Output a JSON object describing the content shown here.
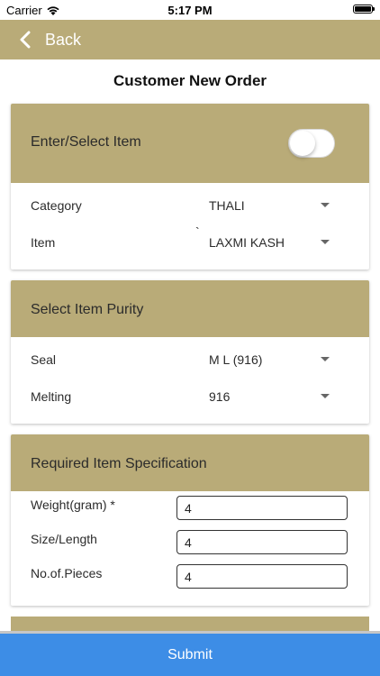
{
  "status_bar": {
    "carrier": "Carrier",
    "time": "5:17 PM",
    "wifi_icon": "wifi-icon",
    "battery_icon": "battery-icon"
  },
  "nav": {
    "back_label": "Back",
    "back_icon": "chevron-left-icon"
  },
  "page_title": "Customer New Order",
  "enter_select_item": {
    "title": "Enter/Select Item",
    "toggle_on": false,
    "category": {
      "label": "Category",
      "value": "THALI"
    },
    "item": {
      "label": "Item",
      "value": "LAXMI KASH",
      "tick": "`"
    }
  },
  "item_purity": {
    "title": "Select Item Purity",
    "seal": {
      "label": "Seal",
      "value": "M L (916)"
    },
    "melting": {
      "label": "Melting",
      "value": "916"
    }
  },
  "item_spec": {
    "title": "Required Item Specification",
    "weight": {
      "label": "Weight(gram) *",
      "value": "4"
    },
    "size": {
      "label": "Size/Length",
      "value": "4"
    },
    "pieces": {
      "label": "No.of.Pieces",
      "value": "4"
    }
  },
  "submit_label": "Submit",
  "colors": {
    "header": "#b9ab78",
    "submit": "#3d8de6"
  }
}
